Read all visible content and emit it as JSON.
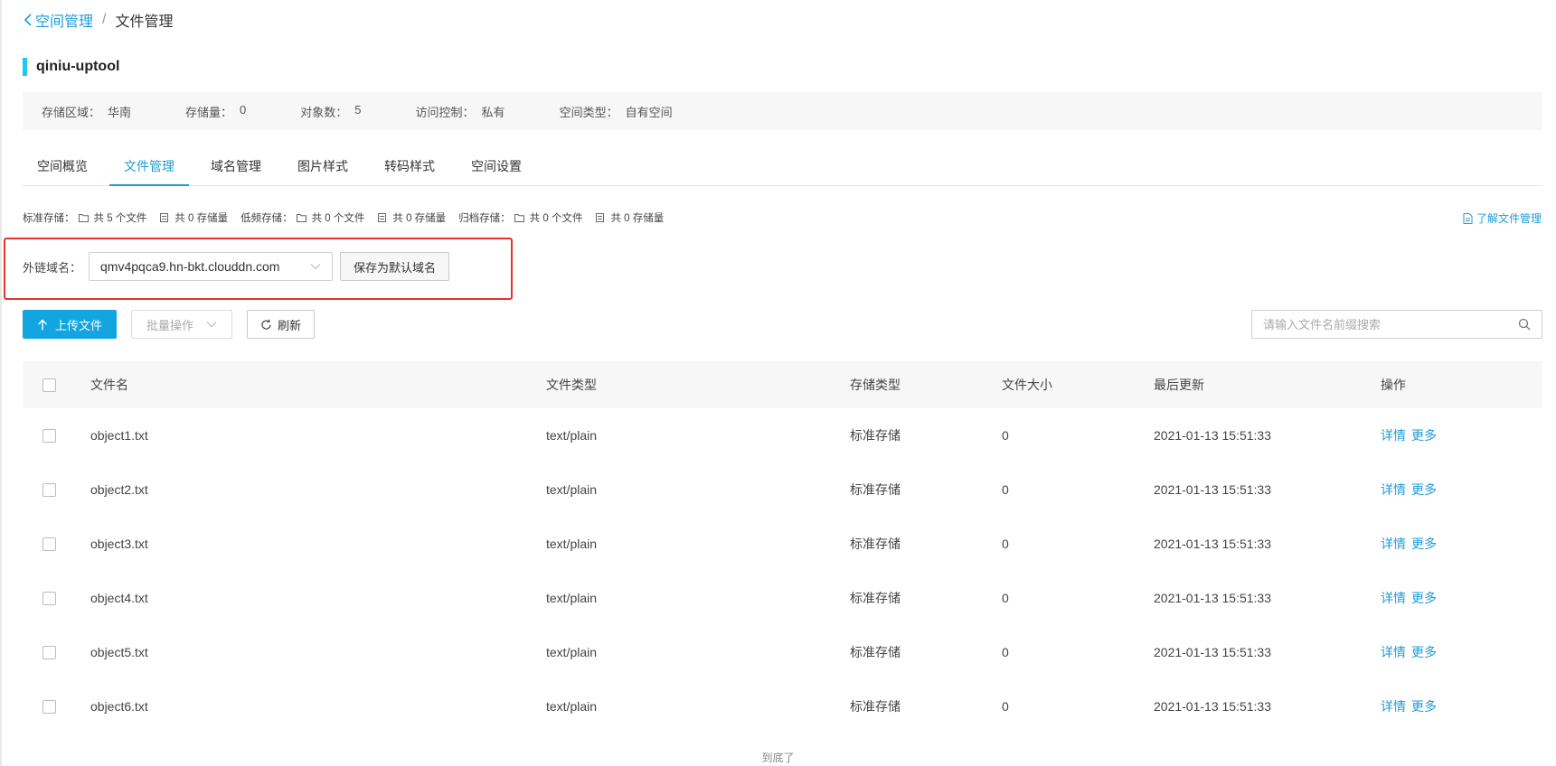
{
  "breadcrumb": {
    "back": "空间管理",
    "separator": "/",
    "current": "文件管理"
  },
  "bucket": {
    "name": "qiniu-uptool"
  },
  "info": [
    {
      "label": "存储区域：",
      "value": "华南"
    },
    {
      "label": "存储量：",
      "value": "0"
    },
    {
      "label": "对象数：",
      "value": "5"
    },
    {
      "label": "访问控制：",
      "value": "私有"
    },
    {
      "label": "空间类型：",
      "value": "自有空间"
    }
  ],
  "tabs": [
    "空间概览",
    "文件管理",
    "域名管理",
    "图片样式",
    "转码样式",
    "空间设置"
  ],
  "stats": {
    "standard_label": "标准存储：",
    "standard_files": "共 5 个文件",
    "standard_size": "共 0 存储量",
    "low_label": "低频存储：",
    "low_files": "共 0 个文件",
    "low_size": "共 0 存储量",
    "archive_label": "归档存储：",
    "archive_files": "共 0 个文件",
    "archive_size": "共 0 存储量",
    "learn_link": "了解文件管理"
  },
  "domain": {
    "label": "外链域名：",
    "value": "qmv4pqca9.hn-bkt.clouddn.com",
    "save_button": "保存为默认域名"
  },
  "toolbar": {
    "upload": "上传文件",
    "batch": "批量操作",
    "refresh": "刷新"
  },
  "search": {
    "placeholder": "请输入文件名前缀搜索"
  },
  "table": {
    "headers": {
      "name": "文件名",
      "type": "文件类型",
      "storage": "存储类型",
      "size": "文件大小",
      "updated": "最后更新",
      "ops": "操作"
    },
    "rows": [
      {
        "name": "object1.txt",
        "type": "text/plain",
        "storage": "标准存储",
        "size": "0",
        "updated": "2021-01-13 15:51:33",
        "detail": "详情",
        "more": "更多"
      },
      {
        "name": "object2.txt",
        "type": "text/plain",
        "storage": "标准存储",
        "size": "0",
        "updated": "2021-01-13 15:51:33",
        "detail": "详情",
        "more": "更多"
      },
      {
        "name": "object3.txt",
        "type": "text/plain",
        "storage": "标准存储",
        "size": "0",
        "updated": "2021-01-13 15:51:33",
        "detail": "详情",
        "more": "更多"
      },
      {
        "name": "object4.txt",
        "type": "text/plain",
        "storage": "标准存储",
        "size": "0",
        "updated": "2021-01-13 15:51:33",
        "detail": "详情",
        "more": "更多"
      },
      {
        "name": "object5.txt",
        "type": "text/plain",
        "storage": "标准存储",
        "size": "0",
        "updated": "2021-01-13 15:51:33",
        "detail": "详情",
        "more": "更多"
      },
      {
        "name": "object6.txt",
        "type": "text/plain",
        "storage": "标准存储",
        "size": "0",
        "updated": "2021-01-13 15:51:33",
        "detail": "详情",
        "more": "更多"
      }
    ]
  },
  "footer": {
    "end_text": "到底了"
  }
}
